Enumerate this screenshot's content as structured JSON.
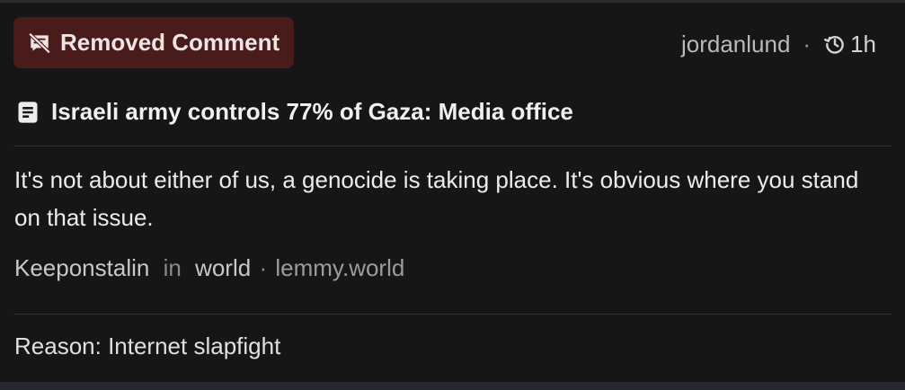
{
  "badge": {
    "label": "Removed Comment",
    "icon": "comment-off-icon",
    "color": "#4a1b1b"
  },
  "meta": {
    "moderator": "jordanlund",
    "separator": "·",
    "time": "1h",
    "time_icon": "history-icon"
  },
  "post": {
    "title": "Israeli army controls 77% of Gaza: Media office",
    "icon": "document-icon"
  },
  "comment": {
    "body": "It's not about either of us, a genocide is taking place. It's obvious where you stand on that issue.",
    "author": "Keeponstalin",
    "in_word": "in",
    "community": "world",
    "separator": "·",
    "instance": "lemmy.world"
  },
  "reason": "Reason: Internet slapfight"
}
